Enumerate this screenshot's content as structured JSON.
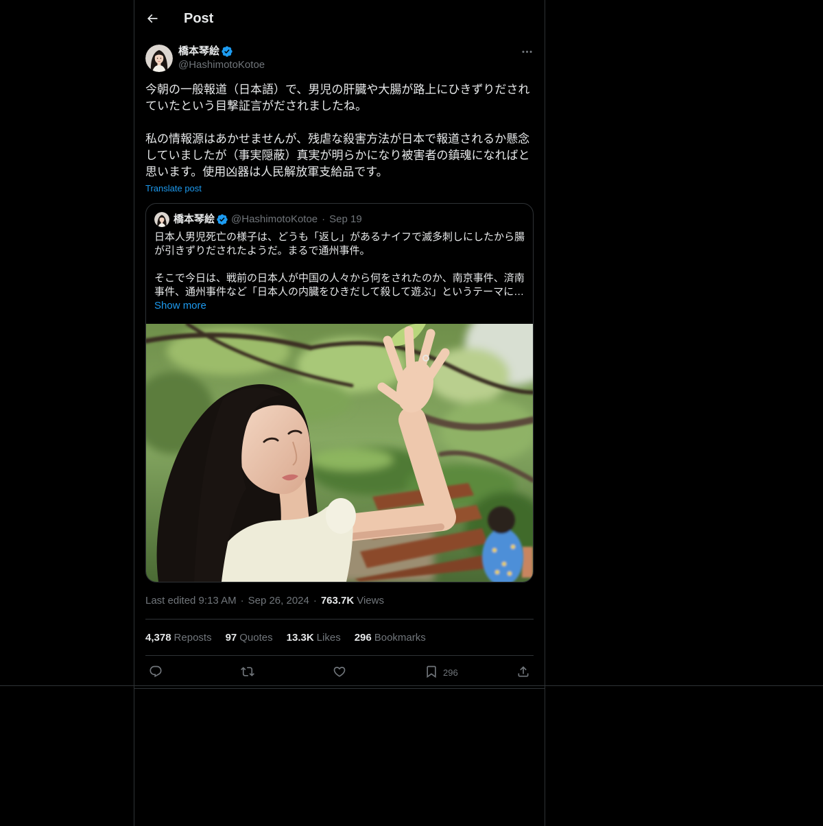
{
  "header": {
    "title": "Post"
  },
  "tweet": {
    "author": {
      "name": "橋本琴絵",
      "handle": "@HashimotoKotoe"
    },
    "paragraphs": [
      [
        "今朝の一般報道（日本語）で、男児の肝臓や大腸が路上にひきずりだされ",
        "ていたという目撃証言がだされましたね。"
      ],
      [
        "私の情報源はあかせませんが、残虐な殺害方法が日本で報道されるか懸念",
        "していましたが（事実隠蔽）真実が明らかになり被害者の鎮魂になればと",
        "思います。使用凶器は人民解放軍支給品です。"
      ]
    ],
    "translate_label": "Translate post",
    "quote": {
      "author": {
        "name": "橋本琴絵",
        "handle": "@HashimotoKotoe"
      },
      "separator": "·",
      "date": "Sep 19",
      "paragraphs": [
        [
          "日本人男児死亡の様子は、どうも「返し」があるナイフで滅多刺しにしたから腸",
          "が引きずりだされたようだ。まるで通州事件。"
        ],
        [
          "そこで今日は、戦前の日本人が中国の人々から何をされたのか、南京事件、済南",
          "事件、通州事件など「日本人の内臓をひきだして殺して遊ぶ」というテーマに…"
        ]
      ],
      "show_more_label": "Show more"
    },
    "meta": {
      "edited_time": "Last edited 9:13 AM",
      "separator": "·",
      "date": "Sep 26, 2024",
      "views_count": "763.7K",
      "views_label": "Views"
    },
    "stats": [
      {
        "count": "4,378",
        "label": "Reposts"
      },
      {
        "count": "97",
        "label": "Quotes"
      },
      {
        "count": "13.3K",
        "label": "Likes"
      },
      {
        "count": "296",
        "label": "Bookmarks"
      }
    ],
    "actions": {
      "bookmark_count": "296"
    }
  },
  "icons": {
    "back": "arrow-left-icon",
    "more": "more-icon",
    "verified": "verified-badge-icon",
    "reply": "reply-icon",
    "repost": "repost-icon",
    "like": "like-icon",
    "bookmark": "bookmark-icon",
    "share": "share-icon"
  },
  "colors": {
    "background": "#000000",
    "text": "#e7e9ea",
    "secondary_text": "#71767b",
    "accent": "#1d9bf0",
    "border": "#2f3336"
  }
}
